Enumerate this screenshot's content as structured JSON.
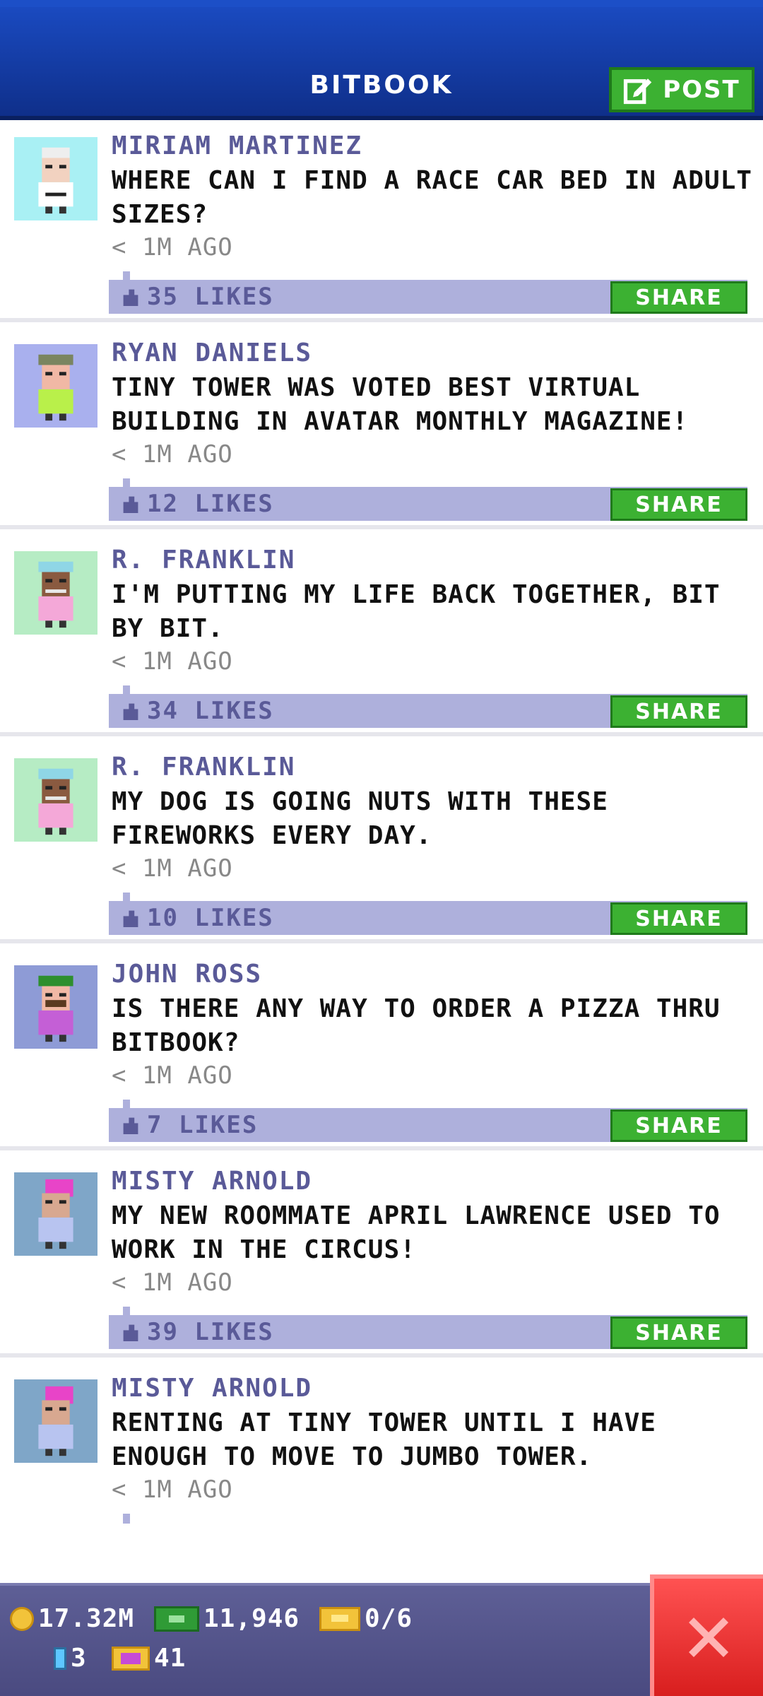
{
  "header": {
    "title": "BITBOOK",
    "post_label": "POST",
    "post_icon": "edit-icon"
  },
  "posts": [
    {
      "name": "MIRIAM MARTINEZ",
      "text": "WHERE CAN I FIND A RACE CAR BED IN ADULT SIZES?",
      "time": "< 1M AGO",
      "likes": "35 LIKES",
      "share": "SHARE",
      "avatar_bg": "#a9f0f4"
    },
    {
      "name": "RYAN DANIELS",
      "text": "TINY TOWER WAS VOTED BEST VIRTUAL BUILDING IN AVATAR MONTHLY MAGAZINE!",
      "time": "< 1M AGO",
      "likes": "12 LIKES",
      "share": "SHARE",
      "avatar_bg": "#a9b0ee"
    },
    {
      "name": "R. FRANKLIN",
      "text": "I'M PUTTING MY LIFE BACK TOGETHER, BIT BY BIT.",
      "time": "< 1M AGO",
      "likes": "34 LIKES",
      "share": "SHARE",
      "avatar_bg": "#b6ecc4"
    },
    {
      "name": "R. FRANKLIN",
      "text": "MY DOG IS GOING NUTS WITH THESE FIREWORKS EVERY DAY.",
      "time": "< 1M AGO",
      "likes": "10 LIKES",
      "share": "SHARE",
      "avatar_bg": "#b6ecc4"
    },
    {
      "name": "JOHN ROSS",
      "text": "IS THERE ANY WAY TO ORDER A PIZZA THRU BITBOOK?",
      "time": "< 1M AGO",
      "likes": "7 LIKES",
      "share": "SHARE",
      "avatar_bg": "#8e9bd6"
    },
    {
      "name": "MISTY ARNOLD",
      "text": "MY NEW ROOMMATE APRIL LAWRENCE USED TO WORK IN THE CIRCUS!",
      "time": "< 1M AGO",
      "likes": "39 LIKES",
      "share": "SHARE",
      "avatar_bg": "#7fa6c8"
    },
    {
      "name": "MISTY ARNOLD",
      "text": "RENTING AT TINY TOWER UNTIL I HAVE ENOUGH TO MOVE TO JUMBO TOWER.",
      "time": "< 1M AGO",
      "likes": "",
      "share": "",
      "avatar_bg": "#7fa6c8"
    }
  ],
  "footer": {
    "coins": "17.32M",
    "cash": "11,946",
    "tickets": "0/6",
    "bitizens": "3",
    "bux": "41"
  },
  "colors": {
    "header": "#1a4ac0",
    "accent_green": "#3cb132",
    "likes_bar": "#aeb0dc",
    "name": "#5a5a98",
    "close": "#e52a2a"
  }
}
